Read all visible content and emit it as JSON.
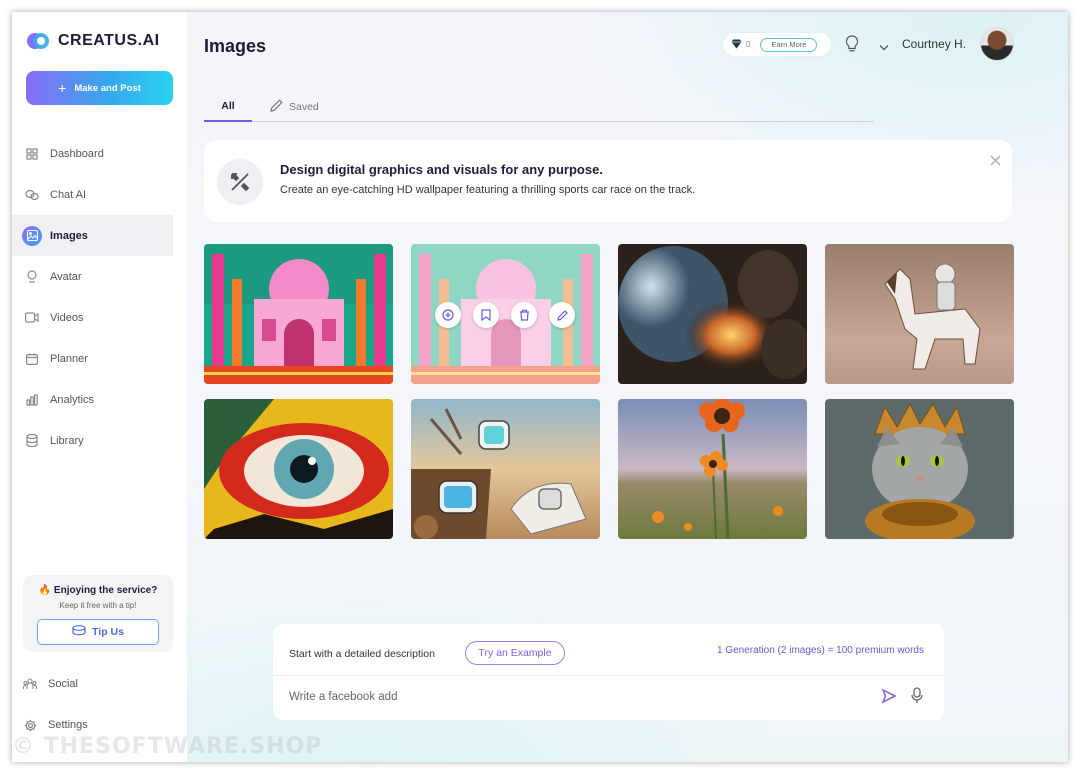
{
  "app": {
    "brand": "CREATUS.AI",
    "make_button": "Make and Post"
  },
  "sidebar": {
    "items": [
      {
        "label": "Dashboard",
        "icon": "dashboard-grid-icon"
      },
      {
        "label": "Chat AI",
        "icon": "chat-bubbles-icon"
      },
      {
        "label": "Images",
        "icon": "image-icon",
        "active": true
      },
      {
        "label": "Avatar",
        "icon": "avatar-person-icon"
      },
      {
        "label": "Videos",
        "icon": "video-camera-icon"
      },
      {
        "label": "Planner",
        "icon": "calendar-icon"
      },
      {
        "label": "Analytics",
        "icon": "bar-chart-icon"
      },
      {
        "label": "Library",
        "icon": "database-icon"
      }
    ],
    "tip_card": {
      "title": "🔥 Enjoying the service?",
      "subtitle": "Keep it free with a tip!",
      "button": "Tip Us"
    },
    "bottom": [
      {
        "label": "Social",
        "icon": "social-people-icon"
      },
      {
        "label": "Settings",
        "icon": "gear-icon"
      }
    ]
  },
  "header": {
    "title": "Images",
    "credits": "0",
    "earn_more": "Earn More",
    "user_name": "Courtney H."
  },
  "tabs": [
    {
      "label": "All",
      "active": true
    },
    {
      "label": "Saved",
      "icon": "pencil-icon"
    }
  ],
  "banner": {
    "title": "Design digital graphics and visuals for any purpose.",
    "subtitle": "Create an eye-catching HD wallpaper featuring a thrilling sports car race on the track."
  },
  "gallery": {
    "images": [
      {
        "subject": "taj-mahal-neon"
      },
      {
        "subject": "taj-mahal-pastel",
        "hovered": true
      },
      {
        "subject": "fantasy-portal-orb"
      },
      {
        "subject": "astronaut-riding-horse"
      },
      {
        "subject": "colorful-eye-closeup"
      },
      {
        "subject": "surreal-melting-watches"
      },
      {
        "subject": "sunflowers-field"
      },
      {
        "subject": "cat-with-crown"
      }
    ],
    "hover_actions": [
      "add-circle-icon",
      "bookmark-icon",
      "trash-icon",
      "edit-pencil-icon"
    ]
  },
  "composer": {
    "hint": "Start with a detailed description",
    "try_button": "Try an Example",
    "generation_info": "1 Generation (2 images) = 100 premium words",
    "placeholder": "Write a facebook add"
  },
  "watermark": "© THESOFTWARE.SHOP",
  "colors": {
    "accent_purple": "#6b5ce7",
    "accent_blue": "#36a6ef",
    "accent_cyan": "#2ad3ee"
  }
}
